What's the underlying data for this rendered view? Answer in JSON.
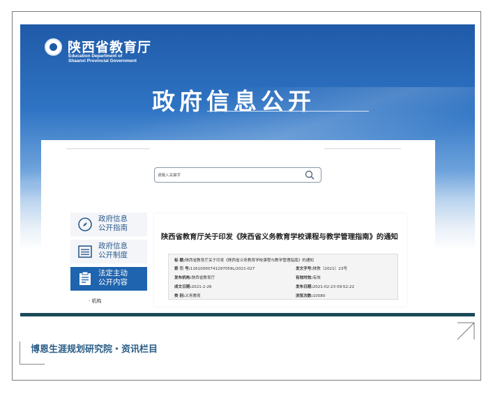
{
  "header": {
    "org_name_cn": "陕西省教育厅",
    "org_name_en_line1": "Education Department of",
    "org_name_en_line2": "Shaanxi Provincial Government",
    "banner_title": "政府信息公开"
  },
  "search": {
    "placeholder": "请输入关键字"
  },
  "sidebar": {
    "items": [
      {
        "label_line1": "政府信息",
        "label_line2": "公开指南",
        "icon": "compass-icon",
        "active": false
      },
      {
        "label_line1": "政府信息",
        "label_line2": "公开制度",
        "icon": "list-icon",
        "active": false
      },
      {
        "label_line1": "法定主动",
        "label_line2": "公开内容",
        "icon": "clipboard-icon",
        "active": true
      }
    ],
    "sub_items": [
      "· 机构"
    ]
  },
  "article": {
    "title": "陕西省教育厅关于印发《陕西省义务教育学校课程与教学管理指南》的通知",
    "meta": {
      "subject_label": "标    题:",
      "subject_value": "陕西省教育厅关于印发《陕西省义务教育学校课程与教学管理指南》的通知",
      "index_label": "索 引 号:",
      "index_value": "11610000741297059L/2021-027",
      "doc_no_label": "发文字号:",
      "doc_no_value": "陕教〔2021〕23号",
      "issuer_label": "发布机构:",
      "issuer_value": "陕西省教育厅",
      "validity_label": "有效时效:",
      "validity_value": "有效",
      "created_label": "成文日期:",
      "created_value": "2021-2-26",
      "published_label": "发布日期:",
      "published_value": "2021-02-23 09:52:22",
      "category_label": "类    别:",
      "category_value": "义务教育",
      "views_label": "浏览次数:",
      "views_value": "10580"
    }
  },
  "footer": {
    "caption": "博恩生涯规划研究院・资讯栏目"
  },
  "colors": {
    "banner_blue": "#1f5aa8",
    "active_menu": "#1f64ae",
    "bottom_bar": "#1d4a58",
    "footer_text": "#2a5d86"
  }
}
